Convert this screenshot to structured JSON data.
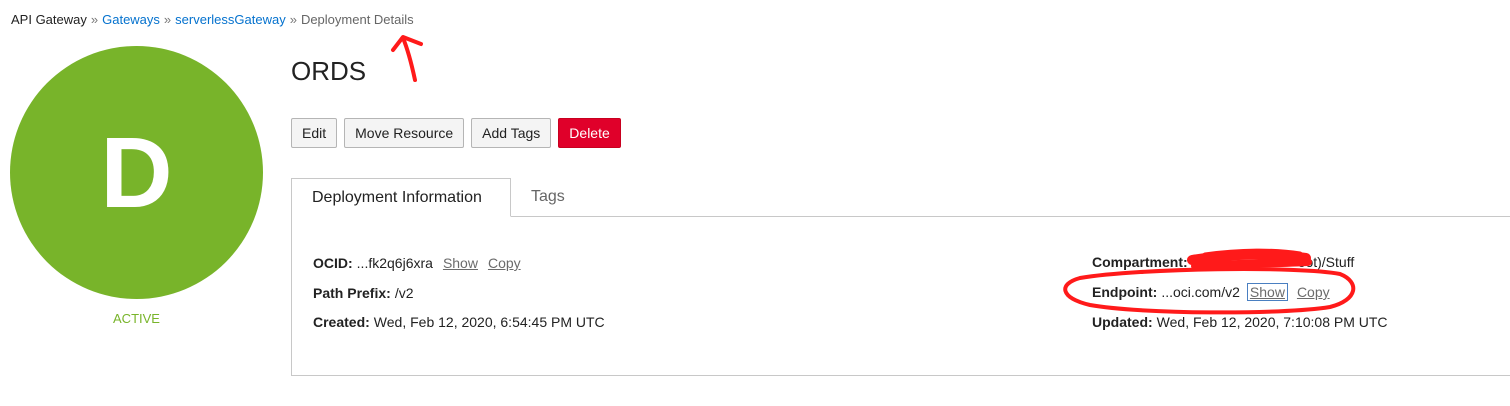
{
  "breadcrumb": {
    "root": "API Gateway",
    "separator": "»",
    "gateways": "Gateways",
    "gateway": "serverlessGateway",
    "current": "Deployment Details"
  },
  "avatar": {
    "letter": "D",
    "color": "#78b42a"
  },
  "status": "ACTIVE",
  "title": "ORDS",
  "actions": {
    "edit": "Edit",
    "move": "Move Resource",
    "add_tags": "Add Tags",
    "delete": "Delete"
  },
  "tabs": {
    "deployment_info": "Deployment Information",
    "tags": "Tags"
  },
  "info": {
    "ocid": {
      "label": "OCID:",
      "value": "...fk2q6j6xra",
      "show": "Show",
      "copy": "Copy"
    },
    "path_prefix": {
      "label": "Path Prefix:",
      "value": "/v2"
    },
    "created": {
      "label": "Created:",
      "value": "Wed, Feb 12, 2020, 6:54:45 PM UTC"
    },
    "compartment": {
      "label": "Compartment:",
      "value_suffix": "oot)/Stuff"
    },
    "endpoint": {
      "label": "Endpoint:",
      "value": "...oci.com/v2",
      "show": "Show",
      "copy": "Copy"
    },
    "updated": {
      "label": "Updated:",
      "value": "Wed, Feb 12, 2020, 7:10:08 PM UTC"
    }
  },
  "colors": {
    "link": "#0572ce",
    "delete": "#e0002a",
    "annotation": "#ff1a1a"
  }
}
